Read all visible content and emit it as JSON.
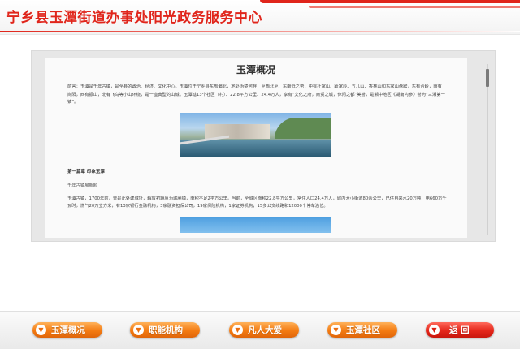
{
  "header": {
    "title": "宁乡县玉潭街道办事处阳光政务服务中心"
  },
  "article": {
    "title": "玉潭概况",
    "intro": "前言：玉潭是千年古镇，是全县的政治、经济、文化中心。玉潭位于宁乡县东部偏北，地处沩楚河畔，至西北至、东南低之势，中有杜家山、跃家岭、五几山、香林山和东家山盘踞，东有合岭，南有尚阳，西有振山，北有飞鸟等小山环绕，是一座典型的山城。玉潭辖13个社区（村）、22.8平方公里、24.4万人，享有“文化之府，商贸之城，休闲之都”美誉，是湘中地区《湖南内参》誉为“三湘第一镇”。",
    "section_head": "第一篇章  印象玉潭",
    "sub_head": "千年古镇展新颜",
    "body": "玉潭古镇，1700年前，曾是此处建城址，解放初期原为城厢镇，面积不足2平方公里。当前，全城区面积22.8平方公里，常住人口24.4万人，城内大小街道80余公里，已供自来水20万吨，电660万千瓦时，燃气20万立方米，有13家银行金融机构，3家融资担保公司，19家保险机构，1家证券机构，15多公交线路和12000个停车泊位。"
  },
  "nav": {
    "items": [
      {
        "label": "玉潭概况"
      },
      {
        "label": "职能机构"
      },
      {
        "label": "凡人大爱"
      },
      {
        "label": "玉潭社区"
      }
    ],
    "back_label": "返 回"
  },
  "icons": {
    "nav_icon": "chevron-down-circle-icon"
  },
  "colors": {
    "brand_red": "#e0251b",
    "button_orange": "#f37b12",
    "button_red": "#e4261a"
  }
}
